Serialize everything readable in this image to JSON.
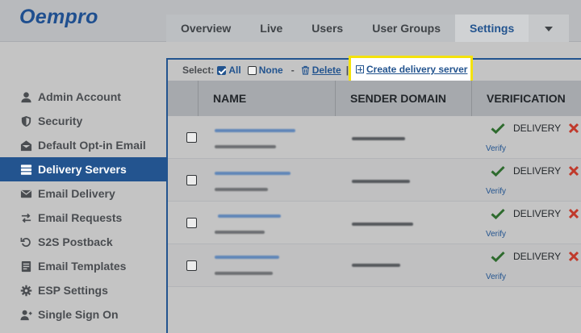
{
  "app": {
    "logo": "Oempro"
  },
  "tabs": [
    {
      "label": "Overview",
      "active": false
    },
    {
      "label": "Live",
      "active": false
    },
    {
      "label": "Users",
      "active": false
    },
    {
      "label": "User Groups",
      "active": false
    },
    {
      "label": "Settings",
      "active": true
    }
  ],
  "sidebar": {
    "items": [
      {
        "label": "Admin Account",
        "icon": "user-icon",
        "active": false
      },
      {
        "label": "Security",
        "icon": "shield-icon",
        "active": false
      },
      {
        "label": "Default Opt-in Email",
        "icon": "envelope-open-icon",
        "active": false
      },
      {
        "label": "Delivery Servers",
        "icon": "server-icon",
        "active": true
      },
      {
        "label": "Email Delivery",
        "icon": "email-delivery-icon",
        "active": false
      },
      {
        "label": "Email Requests",
        "icon": "exchange-arrows-icon",
        "active": false
      },
      {
        "label": "S2S Postback",
        "icon": "refresh-icon",
        "active": false
      },
      {
        "label": "Email Templates",
        "icon": "template-icon",
        "active": false
      },
      {
        "label": "ESP Settings",
        "icon": "gear-icon",
        "active": false
      },
      {
        "label": "Single Sign On",
        "icon": "user-plus-icon",
        "active": false
      }
    ]
  },
  "toolbar": {
    "select_label": "Select:",
    "all_label": "All",
    "none_label": "None",
    "separator": "-",
    "delete_label": "Delete",
    "pipe": "|",
    "create_label": "Create delivery server"
  },
  "table": {
    "headers": {
      "name": "NAME",
      "sender_domain": "SENDER DOMAIN",
      "verification": "VERIFICATION"
    },
    "rows": [
      {
        "verification_status": "DELIVERY",
        "verify_link": "Verify"
      },
      {
        "verification_status": "DELIVERY",
        "verify_link": "Verify"
      },
      {
        "verification_status": "DELIVERY",
        "verify_link": "Verify"
      },
      {
        "verification_status": "DELIVERY",
        "verify_link": "Verify"
      }
    ]
  },
  "colors": {
    "brand": "#23548f",
    "highlight": "#f4e20a",
    "check": "#2e6b2e",
    "error": "#c0392b"
  }
}
